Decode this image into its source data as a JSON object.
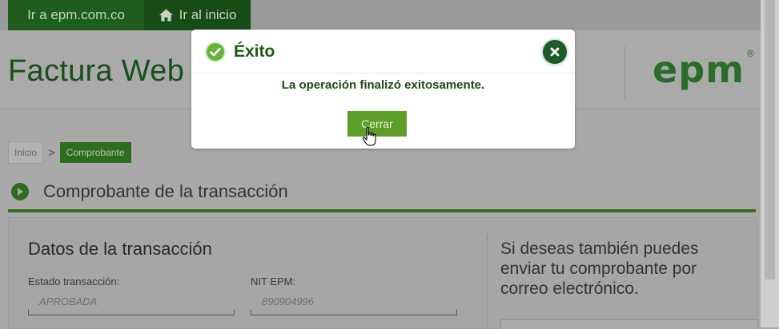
{
  "topbar": {
    "site_link": "Ir a epm.com.co",
    "home_link": "Ir al inicio",
    "home_icon": "home-icon"
  },
  "header": {
    "title": "Factura Web",
    "logo_text": "epm",
    "logo_mark": "®"
  },
  "breadcrumb": {
    "items": [
      "Inicio",
      "Comprobante"
    ],
    "separator": ">"
  },
  "section": {
    "title": "Comprobante de la transacción"
  },
  "transaction": {
    "title": "Datos de la transacción",
    "fields": [
      {
        "label": "Estado transacción:",
        "value": "APROBADA"
      },
      {
        "label": "NIT EPM:",
        "value": "890904996"
      }
    ]
  },
  "email_panel": {
    "text": "Si deseas también puedes enviar tu comprobante por correo electrónico."
  },
  "modal": {
    "title": "Éxito",
    "message": "La operación finalizó exitosamente.",
    "button_label": "Cerrar"
  },
  "colors": {
    "brand_green": "#2a6d2a",
    "success_green": "#67b33a",
    "button_green": "#5c9e27",
    "dark_green": "#1d5a2a"
  }
}
